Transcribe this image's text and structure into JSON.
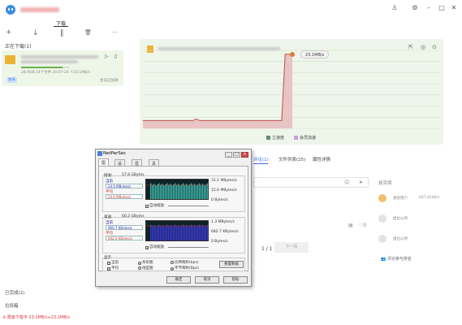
{
  "titlebar": {
    "window_buttons": [
      "shirt-icon",
      "gear-icon",
      "minimize-icon",
      "maximize-icon",
      "close-icon"
    ]
  },
  "top_tabs": {
    "download": "下载"
  },
  "toolbar": {
    "add": "+",
    "download": "↓",
    "pause": "‖",
    "delete": "🗑",
    "more": "···"
  },
  "sidebar": {
    "downloading_title": "正在下载(1)",
    "task": {
      "meta": "28.4GB 24个文件  20:07:24  ↑23.1MB/s",
      "badge": "会员",
      "status": "会员已加速"
    },
    "completed_title": "已完成(2)",
    "trash_title": "垃圾箱"
  },
  "chart_card": {
    "speed_tag": "23.1MB/s",
    "legend": {
      "sort": "立速度",
      "vip": "会员加速"
    },
    "colors": {
      "sort": "#6b8a6b",
      "vip": "#c9a0dc",
      "line": "#c0504d",
      "fill": "#e8c4c4"
    }
  },
  "chart_data": {
    "type": "area",
    "series": [
      {
        "values": [
          0.1,
          0.1,
          0.1,
          0.1,
          0.1,
          0.1,
          0.1,
          0.1,
          0.1,
          0.1,
          0.1,
          0.1,
          0.1,
          0.1,
          0.1,
          0.12,
          0.1,
          0.1,
          0.1,
          0.1,
          0.1,
          0.1,
          0.1,
          0.1,
          0.1,
          0.1,
          0.1,
          0.1,
          0.1,
          0.1,
          0.1,
          0.1,
          0.1,
          0.1,
          0.1,
          0.1,
          0.1,
          0.1,
          0.1,
          0.1,
          0.95,
          0.95,
          0.95
        ]
      }
    ]
  },
  "comments": {
    "tabs": [
      "评论(1)",
      "文件列表(25)",
      "属性详情"
    ],
    "page": "1 / 1",
    "next": "下一页"
  },
  "right_panel": {
    "title": "悬赏榜",
    "users": [
      {
        "name": "悬赏用户",
        "value": "687.82KB/s"
      },
      {
        "name": "虚位以待",
        "value": ""
      },
      {
        "name": "虚位以待",
        "value": ""
      }
    ],
    "rank_link": "评论参与排名"
  },
  "status_bar": {
    "text": "限速下载中  23.1MB/s+23.1MB/s"
  },
  "dialog": {
    "title": "NetPerSec",
    "tabs": [
      "图表",
      "设置",
      "显示",
      "关于"
    ],
    "receive": {
      "label": "接收:",
      "total": "57.8 GBytes",
      "current_label": "当前",
      "current": "24.0 MBytes/s",
      "avg_label": "平均",
      "avg": "24.0 MBytes/s",
      "max": "31.1 MBytes/s",
      "mid": "15.6 MBytes/s",
      "min": "0  Bytes/s",
      "autoscale": "自动缩放"
    },
    "send": {
      "label": "发送:",
      "total": "60.2 GBytes",
      "current_label": "当前",
      "current": "960.7 KBytes/s",
      "avg_label": "平均",
      "avg": "942.5 KBytes/s",
      "max": "1.3 MBytes/s",
      "mid": "682.7 KBytes/s",
      "min": "0  Bytes/s",
      "autoscale": "自动缩放"
    },
    "display": {
      "label": "显示",
      "current": "当前",
      "average": "平均",
      "bar": "条形图",
      "line": "线型图",
      "bps": "比特每秒(bps)",
      "Bps": "字节每秒(Bps)",
      "reset": "重置数据"
    },
    "buttons": {
      "ok": "确定",
      "cancel": "取消",
      "help": "帮助"
    }
  }
}
